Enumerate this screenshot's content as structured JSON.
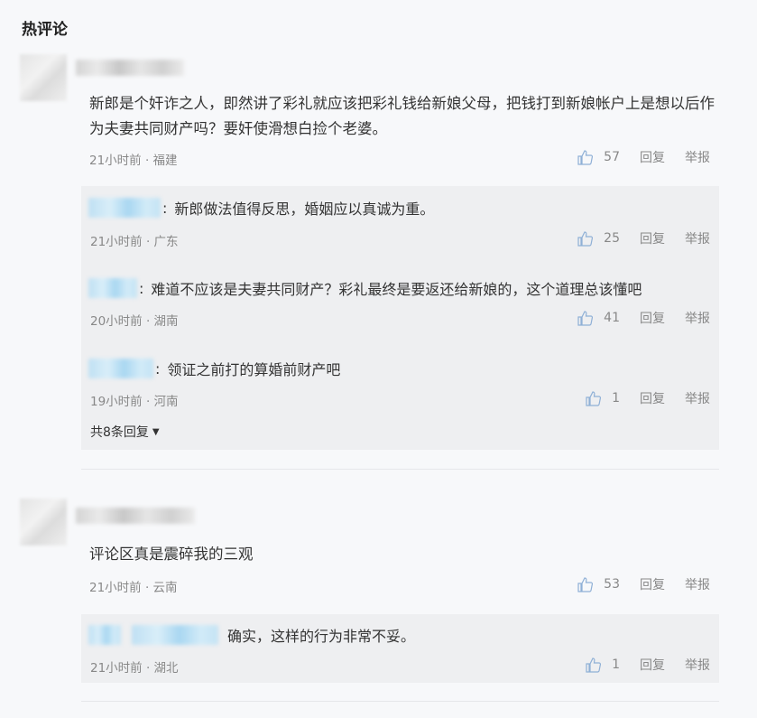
{
  "section_title": "热评论",
  "comment1": {
    "text": "新郎是个奸诈之人，即然讲了彩礼就应该把彩礼钱给新娘父母，把钱打到新娘帐户上是想以后作为夫妻共同财产吗？要奸使滑想白捡个老婆。",
    "meta": "21小时前 · 福建",
    "likes": "57",
    "reply_label": "回复",
    "report_label": "举报",
    "replies": [
      {
        "text": "新郎做法值得反思，婚姻应以真诚为重。",
        "meta": "21小时前 · 广东",
        "likes": "25"
      },
      {
        "text": "难道不应该是夫妻共同财产？彩礼最终是要返还给新娘的，这个道理总该懂吧",
        "meta": "20小时前 · 湖南",
        "likes": "41"
      },
      {
        "text": "领证之前打的算婚前财产吧",
        "meta": "19小时前 · 河南",
        "likes": "1"
      }
    ],
    "more_replies": "共8条回复"
  },
  "comment2": {
    "text": "评论区真是震碎我的三观",
    "meta": "21小时前 · 云南",
    "likes": "53",
    "reply_label": "回复",
    "report_label": "举报",
    "replies": [
      {
        "text": "确实，这样的行为非常不妥。",
        "meta": "21小时前 · 湖北",
        "likes": "1"
      }
    ]
  },
  "colors": {
    "background": "#f7f8fa",
    "reply_background": "#eeeff1",
    "meta_text": "#888888"
  },
  "icons": {
    "like": "thumbs-up-icon",
    "caret": "caret-down-icon"
  }
}
